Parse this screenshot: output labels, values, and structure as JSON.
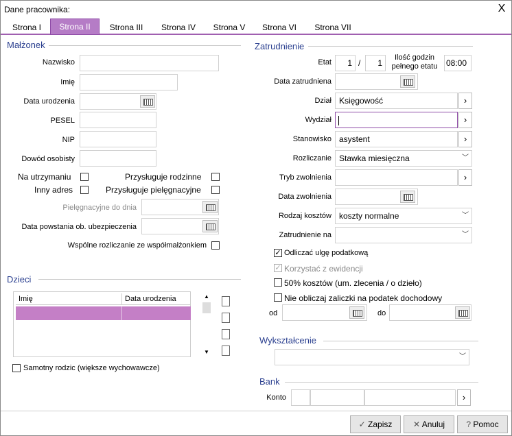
{
  "window": {
    "title": "Dane pracownika:",
    "close_label": "X"
  },
  "tabs": [
    "Strona I",
    "Strona II",
    "Strona III",
    "Strona IV",
    "Strona V",
    "Strona VI",
    "Strona VII"
  ],
  "malzonek": {
    "section": "Małżonek",
    "nazwisko": "Nazwisko",
    "imie": "Imię",
    "data_urodzenia": "Data urodzenia",
    "pesel": "PESEL",
    "nip": "NIP",
    "dowod": "Dowód osobisty",
    "na_utrzymaniu": "Na utrzymaniu",
    "przysluguje_rodzinne": "Przysługuje rodzinne",
    "inny_adres": "Inny adres",
    "przysluguje_pielegnacyjne": "Przysługuje pielęgnacyjne",
    "pielegnacyjne_do_dnia": "Pielęgnacyjne do dnia",
    "data_powstania": "Data powstania ob. ubezpieczenia",
    "wspolne": "Wspólne rozliczanie ze współmałżonkiem"
  },
  "dzieci": {
    "section": "Dzieci",
    "col_imie": "Imię",
    "col_data": "Data urodzenia",
    "samotny": "Samotny rodzic (większe wychowawcze)"
  },
  "zatrudnienie": {
    "section": "Zatrudnienie",
    "etat": "Etat",
    "etat_num": "1",
    "etat_sep": "/",
    "etat_den": "1",
    "ilosc_godzin": "Ilość godzin\npełnego etatu",
    "ilosc_godzin_1": "Ilość godzin",
    "ilosc_godzin_2": "pełnego etatu",
    "godziny": "08:00",
    "data_zatrudniena": "Data zatrudniena",
    "dzial": "Dział",
    "dzial_value": "Księgowość",
    "wydzial": "Wydział",
    "stanowisko": "Stanowisko",
    "stanowisko_value": "asystent",
    "rozliczanie": "Rozliczanie",
    "rozliczanie_value": "Stawka miesięczna",
    "tryb": "Tryb zwolnienia",
    "data_zwolnienia": "Data zwolnienia",
    "rodzaj_kosztow": "Rodzaj kosztów",
    "rodzaj_value": "koszty normalne",
    "zatrudnienie_na": "Zatrudnienie na",
    "odliczac": "Odliczać ulgę podatkową",
    "korzystac": "Korzystać z ewidencji",
    "koszty50": "50% kosztów (um. zlecenia / o dzieło)",
    "nie_obliczaj": "Nie obliczaj zaliczki na podatek dochodowy",
    "od": "od",
    "do": "do"
  },
  "wyksztalcenie": {
    "section": "Wykształcenie"
  },
  "bank": {
    "section": "Bank",
    "konto": "Konto"
  },
  "buttons": {
    "zapisz": "Zapisz",
    "anuluj": "Anuluj",
    "pomoc": "Pomoc"
  },
  "colors": {
    "accent": "#b57cc6",
    "section": "#2a3f8f",
    "selected_row": "#c47fc6"
  }
}
